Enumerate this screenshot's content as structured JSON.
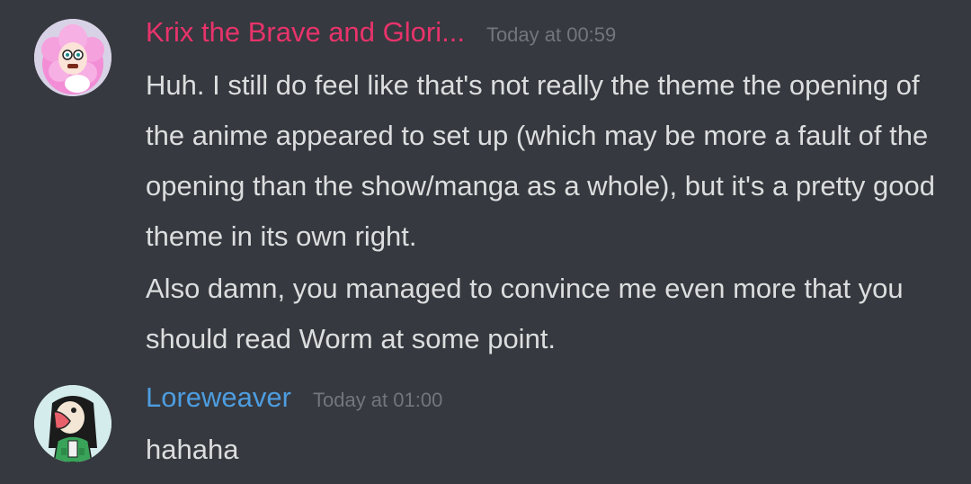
{
  "colors": {
    "background": "#36393f",
    "text": "#dcddde",
    "timestamp": "#72767d"
  },
  "messages": [
    {
      "author": "Krix the Brave and Glori...",
      "author_color": "#e8336b",
      "timestamp": "Today at 00:59",
      "avatar_icon": "pink-haired-character-avatar",
      "paragraphs": [
        "Huh. I still do feel like that's not really the theme the opening of the anime appeared to set up (which may be more a fault of the opening than the show/manga as a whole), but it's a pretty good theme in its own right.",
        "Also damn, you managed to convince me even more that you should read Worm at some point."
      ]
    },
    {
      "author": "Loreweaver",
      "author_color": "#4d9de0",
      "timestamp": "Today at 01:00",
      "avatar_icon": "frog-girl-character-avatar",
      "paragraphs": [
        "hahaha"
      ]
    }
  ]
}
